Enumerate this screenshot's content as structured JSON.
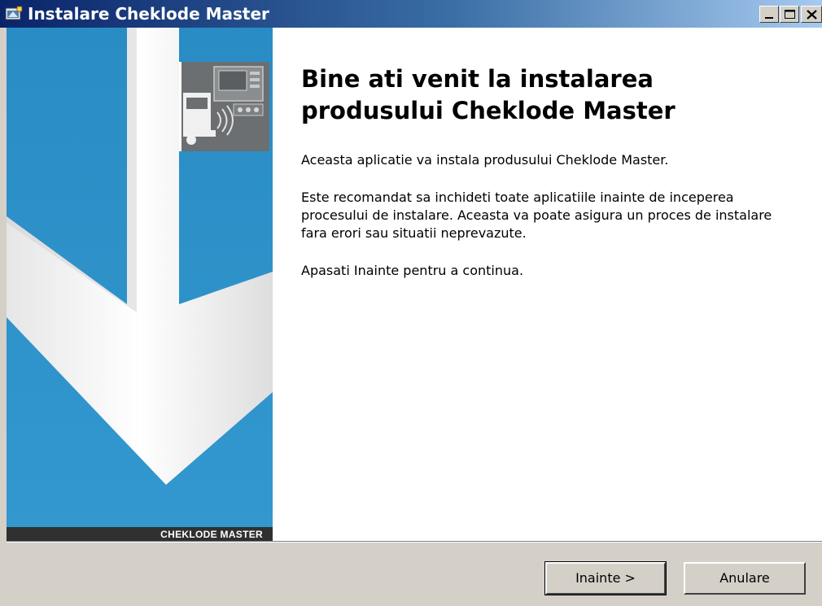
{
  "window": {
    "title": "Instalare Cheklode Master",
    "icon": "installer-icon",
    "controls": [
      "minimize-icon",
      "maximize-icon",
      "close-icon"
    ]
  },
  "banner": {
    "brand_text": "CHEKLODE MASTER",
    "logo": "truck-scanner-icon",
    "colors": {
      "background": "#2e92c8",
      "arrow": "#ffffff",
      "footer": "#303030"
    }
  },
  "main": {
    "heading": "Bine ati venit la instalarea produsului Cheklode Master",
    "paragraphs": [
      "Aceasta aplicatie va instala produsului Cheklode Master.",
      "Este recomandat sa inchideti toate aplicatiile inainte de inceperea procesului de instalare. Aceasta va poate asigura un proces de instalare fara erori sau situatii neprevazute.",
      "Apasati Inainte pentru a continua."
    ]
  },
  "buttons": {
    "next_label": "Inainte >",
    "cancel_label": "Anulare"
  }
}
